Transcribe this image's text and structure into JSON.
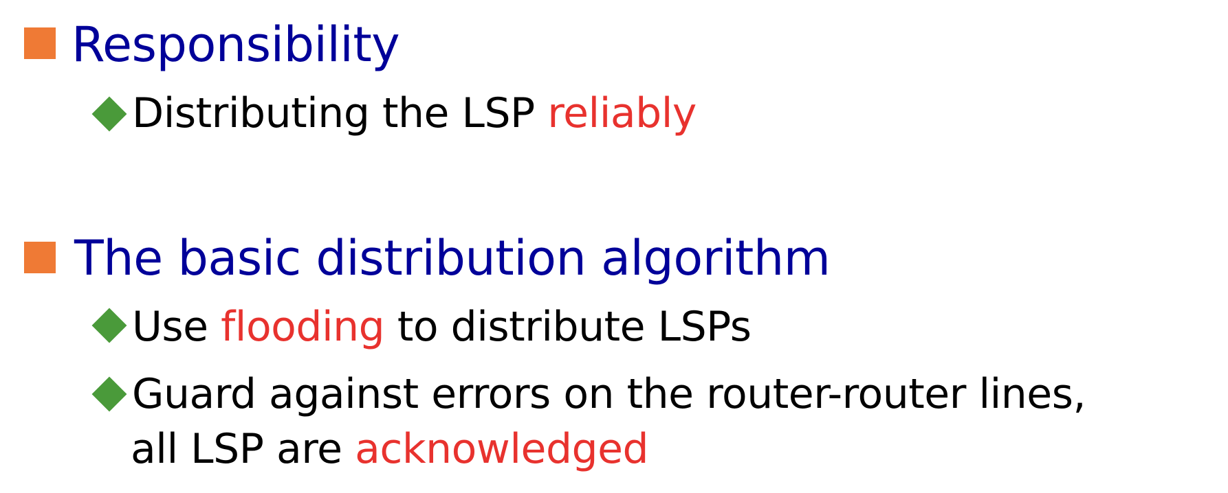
{
  "colors": {
    "heading": "#000099",
    "body": "#000000",
    "highlight": "#e8322e",
    "square_bullet": "#ef7a35",
    "diamond_bullet": "#4a9a3a"
  },
  "sections": [
    {
      "heading": "Responsibility",
      "items": [
        {
          "line1_pre": "Distributing the LSP ",
          "line1_hl": "reliably"
        }
      ]
    },
    {
      "heading": "The basic distribution algorithm",
      "items": [
        {
          "line1_pre": "Use ",
          "line1_hl": "flooding",
          "line1_post": " to distribute LSPs"
        },
        {
          "line1": "Guard against errors on the router-router lines,",
          "line2_pre": "all LSP are ",
          "line2_hl": "acknowledged"
        }
      ]
    }
  ]
}
